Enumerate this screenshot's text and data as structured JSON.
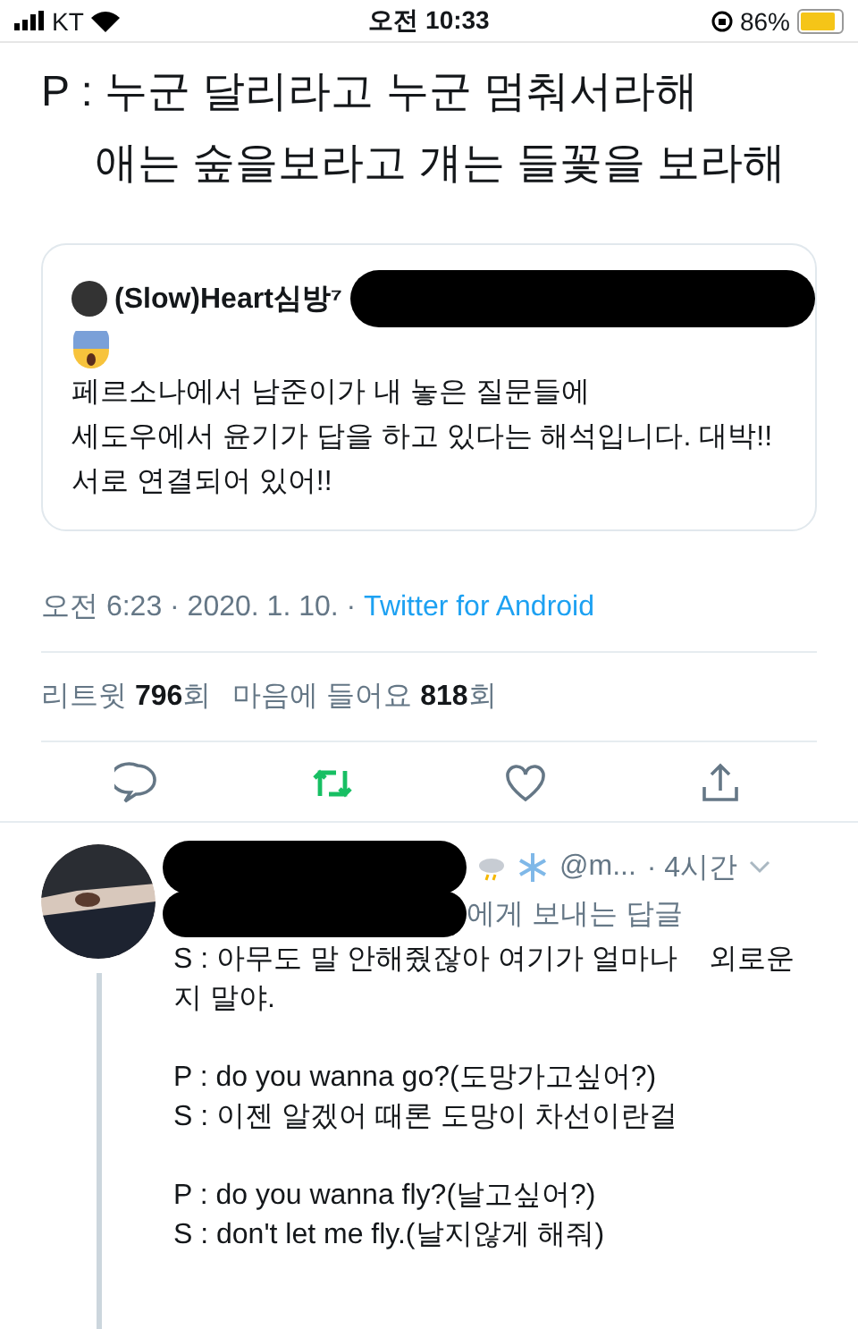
{
  "status_bar": {
    "carrier": "KT",
    "time": "오전 10:33",
    "battery": "86%"
  },
  "tweet": {
    "lines": [
      "P : 누군 달리라고 누군 멈춰서라해",
      "애는 숲을보라고 걔는 들꽃을 보라해"
    ],
    "quote": {
      "name": "(Slow)Heart심방⁷",
      "body": [
        "페르소나에서 남준이가 내 놓은 질문들에",
        "세도우에서 윤기가 답을 하고 있다는 해석입니다. 대박!!",
        "서로 연결되어 있어!!"
      ]
    },
    "meta": {
      "time": "오전 6:23 · 2020. 1. 10. · ",
      "source": "Twitter for Android"
    },
    "stats": [
      {
        "label": "리트윗",
        "count": "796",
        "unit": "회"
      },
      {
        "label": "마음에 들어요",
        "count": "818",
        "unit": "회"
      }
    ],
    "actions": [
      {
        "kind": "reply",
        "selected": false
      },
      {
        "kind": "retweet",
        "selected": true
      },
      {
        "kind": "like",
        "selected": false
      },
      {
        "kind": "share",
        "selected": false
      }
    ]
  },
  "reply": {
    "handle": "@m...",
    "time": "· 4시간",
    "reply_to": "에게 보내는 답글",
    "paragraphs": [
      [
        "S : 아무도 말 안해줬잖아 여기가 얼마나    외로운 지 말야."
      ],
      [
        "P : do you wanna go?(도망가고싶어?)",
        "S : 이젠 알겠어 때론 도망이 차선이란걸"
      ],
      [
        "P : do you wanna fly?(날고싶어?)",
        "S : don't let me fly.(날지않게 해줘)"
      ]
    ]
  }
}
